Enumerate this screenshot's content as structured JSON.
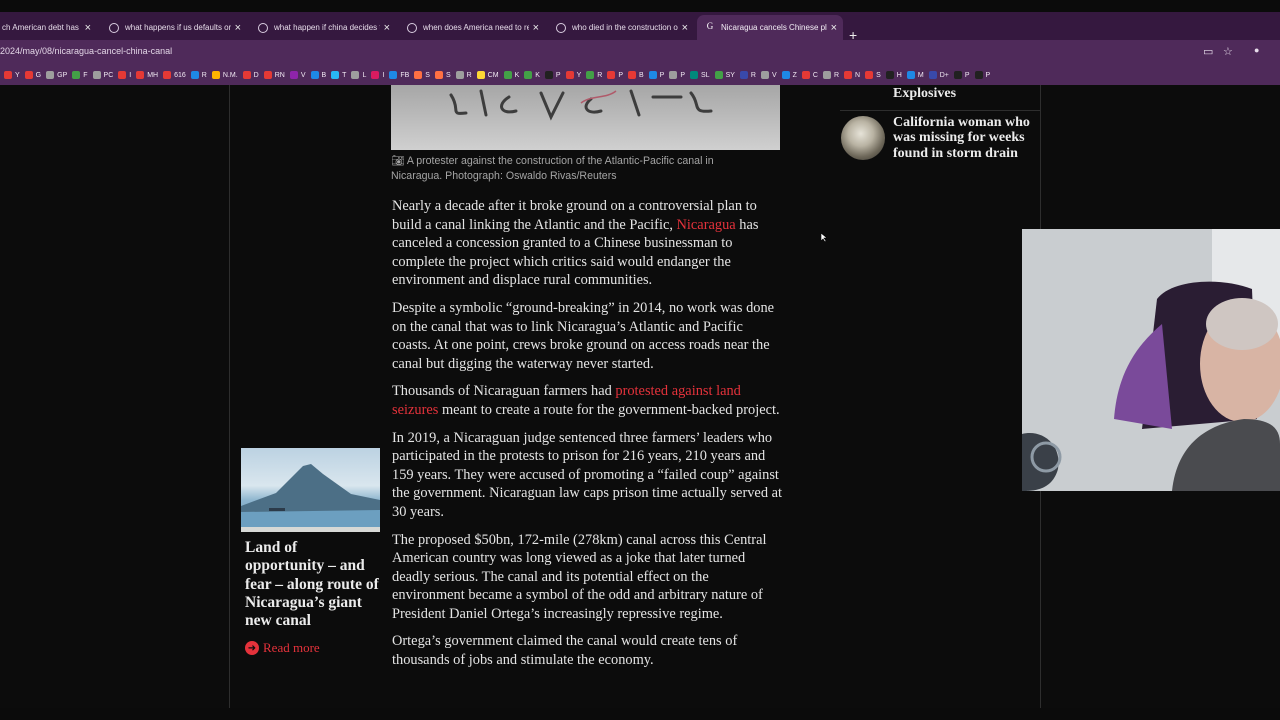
{
  "tabs": [
    {
      "title": "ch American debt has",
      "active": false
    },
    {
      "title": "what happens if us defaults on",
      "active": false
    },
    {
      "title": "what happen if china decides t",
      "active": false
    },
    {
      "title": "when does America need to re",
      "active": false
    },
    {
      "title": "who died in the construction o",
      "active": false
    },
    {
      "title": "Nicaragua cancels Chinese plan",
      "active": true
    }
  ],
  "new_tab_label": "+",
  "address": {
    "url": "2024/may/08/nicaragua-cancel-china-canal"
  },
  "bookmarks": [
    {
      "label": "Y",
      "color": "#e53935"
    },
    {
      "label": "G",
      "color": "#e53935"
    },
    {
      "label": "GP",
      "color": "#9e9e9e"
    },
    {
      "label": "F",
      "color": "#43a047"
    },
    {
      "label": "PC",
      "color": "#9e9e9e"
    },
    {
      "label": "I",
      "color": "#e53935"
    },
    {
      "label": "MH",
      "color": "#e53935"
    },
    {
      "label": "616",
      "color": "#e53935"
    },
    {
      "label": "R",
      "color": "#1e88e5"
    },
    {
      "label": "N.M.",
      "color": "#ffb300"
    },
    {
      "label": "D",
      "color": "#e53935"
    },
    {
      "label": "RN",
      "color": "#e53935"
    },
    {
      "label": "V",
      "color": "#8e24aa"
    },
    {
      "label": "B",
      "color": "#1e88e5"
    },
    {
      "label": "T",
      "color": "#29b6f6"
    },
    {
      "label": "L",
      "color": "#9e9e9e"
    },
    {
      "label": "I",
      "color": "#d81b60"
    },
    {
      "label": "FB",
      "color": "#1e88e5"
    },
    {
      "label": "S",
      "color": "#ff7043"
    },
    {
      "label": "S",
      "color": "#ff7043"
    },
    {
      "label": "R",
      "color": "#9e9e9e"
    },
    {
      "label": "CM",
      "color": "#fdd835"
    },
    {
      "label": "K",
      "color": "#43a047"
    },
    {
      "label": "K",
      "color": "#43a047"
    },
    {
      "label": "P",
      "color": "#212121"
    },
    {
      "label": "Y",
      "color": "#e53935"
    },
    {
      "label": "R",
      "color": "#43a047"
    },
    {
      "label": "P",
      "color": "#e53935"
    },
    {
      "label": "B",
      "color": "#e53935"
    },
    {
      "label": "P",
      "color": "#1e88e5"
    },
    {
      "label": "P",
      "color": "#9e9e9e"
    },
    {
      "label": "SL",
      "color": "#00897b"
    },
    {
      "label": "SY",
      "color": "#43a047"
    },
    {
      "label": "R",
      "color": "#3949ab"
    },
    {
      "label": "V",
      "color": "#9e9e9e"
    },
    {
      "label": "Z",
      "color": "#1e88e5"
    },
    {
      "label": "C",
      "color": "#e53935"
    },
    {
      "label": "R",
      "color": "#9e9e9e"
    },
    {
      "label": "N",
      "color": "#e53935"
    },
    {
      "label": "S",
      "color": "#e53935"
    },
    {
      "label": "H",
      "color": "#212121"
    },
    {
      "label": "M",
      "color": "#1e88e5"
    },
    {
      "label": "D+",
      "color": "#3949ab"
    },
    {
      "label": "P",
      "color": "#212121"
    },
    {
      "label": "P",
      "color": "#212121"
    }
  ],
  "caption": "A protester against the construction of the Atlantic-Pacific canal in Nicaragua. Photograph: Oswaldo Rivas/Reuters",
  "article": {
    "p1_before": "Nearly a decade after it broke ground on a controversial plan to build a canal linking the Atlantic and the Pacific, ",
    "p1_link": "Nicaragua",
    "p1_after": " has canceled a concession granted to a Chinese businessman to complete the project which critics said would endanger the environment and displace rural communities.",
    "p2": "Despite a symbolic “ground-breaking” in 2014, no work was done on the canal that was to link Nicaragua’s Atlantic and Pacific coasts. At one point, crews broke ground on access roads near the canal but digging the waterway never started.",
    "p3_before": "Thousands of Nicaraguan farmers had ",
    "p3_link": "protested against land seizures",
    "p3_after": " meant to create a route for the government-backed project.",
    "p4": "In 2019, a Nicaraguan judge sentenced three farmers’ leaders who participated in the protests to prison for 216 years, 210 years and 159 years. They were accused of promoting a “failed coup” against the government. Nicaraguan law caps prison time actually served at 30 years.",
    "p5": "The proposed $50bn, 172-mile (278km) canal across this Central American country was long viewed as a joke that later turned deadly serious. The canal and its potential effect on the environment became a symbol of the odd and arbitrary nature of President Daniel Ortega’s increasingly repressive regime.",
    "p6": "Ortega’s government claimed the canal would create tens of thousands of jobs and stimulate the economy."
  },
  "promo": {
    "title": "Land of opportunity – and fear – along route of Nicaragua’s giant new canal",
    "read_more": "Read more"
  },
  "sidebar": {
    "prev_title_tail": "Explosives",
    "story_title": "California woman who was missing for weeks found in storm drain"
  }
}
